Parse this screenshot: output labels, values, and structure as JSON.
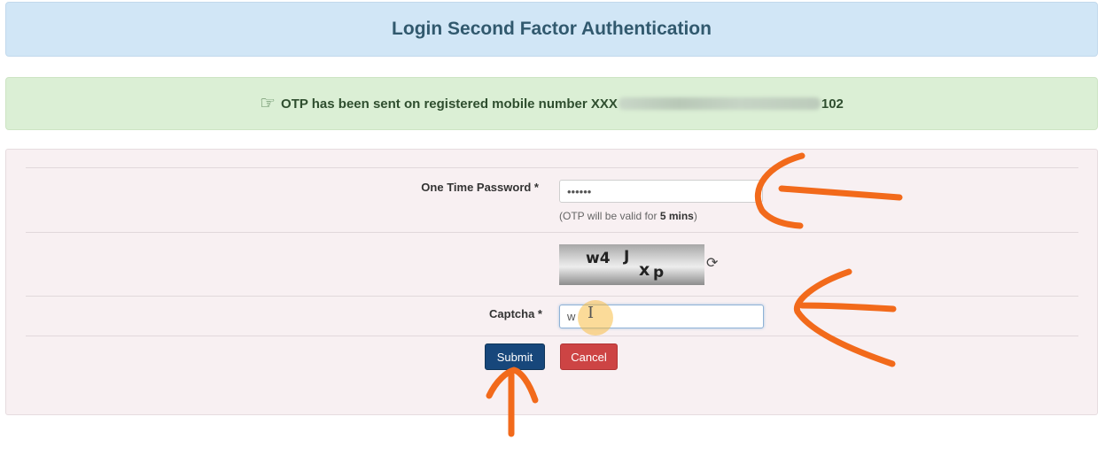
{
  "header": {
    "title": "Login Second Factor Authentication"
  },
  "alert": {
    "icon": "hand-point-right-icon",
    "text_before": "OTP has been sent on registered mobile number XXX",
    "text_after": "102"
  },
  "form": {
    "otp": {
      "label": "One Time Password *",
      "value": "••••••",
      "hint_prefix": "(OTP will be valid for ",
      "hint_bold": "5 mins",
      "hint_suffix": ")"
    },
    "captcha_image": {
      "chars": [
        "w4",
        "J",
        "x",
        "p"
      ]
    },
    "refresh_icon": "refresh-icon",
    "captcha": {
      "label": "Captcha *",
      "value": "w"
    },
    "submit_label": "Submit",
    "cancel_label": "Cancel"
  },
  "colors": {
    "header_bg": "#d1e6f6",
    "header_text": "#31596e",
    "alert_bg": "#dbefd5",
    "panel_bg": "#f8f0f2",
    "submit_bg": "#17477b",
    "cancel_bg": "#cd4444",
    "annotation": "#f26a1b"
  }
}
